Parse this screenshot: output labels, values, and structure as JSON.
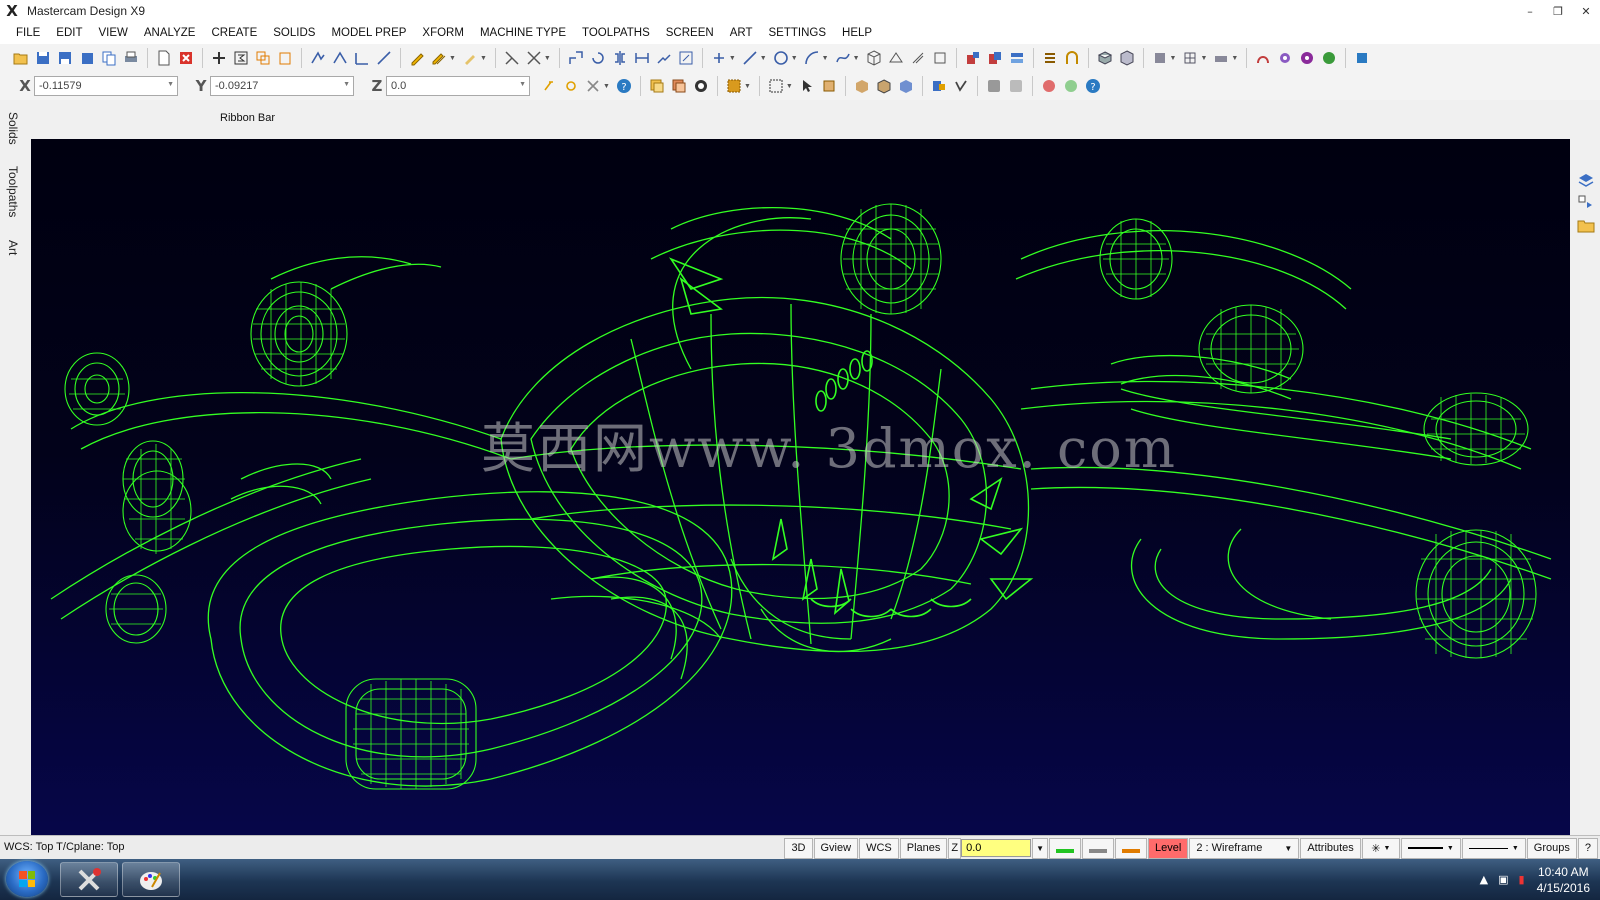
{
  "window": {
    "title": "Mastercam Design X9",
    "logo": "X",
    "minimize": "–",
    "restore": "❐",
    "close": "✕"
  },
  "menu": [
    "FILE",
    "EDIT",
    "VIEW",
    "ANALYZE",
    "CREATE",
    "SOLIDS",
    "MODEL PREP",
    "XFORM",
    "MACHINE TYPE",
    "TOOLPATHS",
    "SCREEN",
    "ART",
    "SETTINGS",
    "HELP"
  ],
  "coords": {
    "x_label": "X",
    "x_value": "-0.11579",
    "y_label": "Y",
    "y_value": "-0.09217",
    "z_label": "Z",
    "z_value": "0.0"
  },
  "ribbon": {
    "label": "Ribbon Bar"
  },
  "left_tabs": [
    "Solids",
    "Toolpaths",
    "Art"
  ],
  "viewport": {
    "watermark": "莫西网www. 3dmox. com",
    "wire_color": "#33ff22",
    "bg_top": "#000010",
    "bg_bottom": "#060649"
  },
  "status": {
    "left_text": "WCS: Top   T/Cplane: Top",
    "btn_3d": "3D",
    "btn_gview": "Gview",
    "btn_wcs": "WCS",
    "btn_planes": "Planes",
    "z_label": "Z",
    "z_value": "0.0",
    "level_label": "Level",
    "level_value": "2 : Wireframe",
    "attributes": "Attributes",
    "point_style": "✳",
    "groups": "Groups",
    "help": "?"
  },
  "taskbar": {
    "time": "10:40 AM",
    "date": "4/15/2016"
  },
  "colors": {
    "accent": "#33ff22",
    "level_bg": "#ff6b6b",
    "z_input_bg": "#ffff80"
  }
}
